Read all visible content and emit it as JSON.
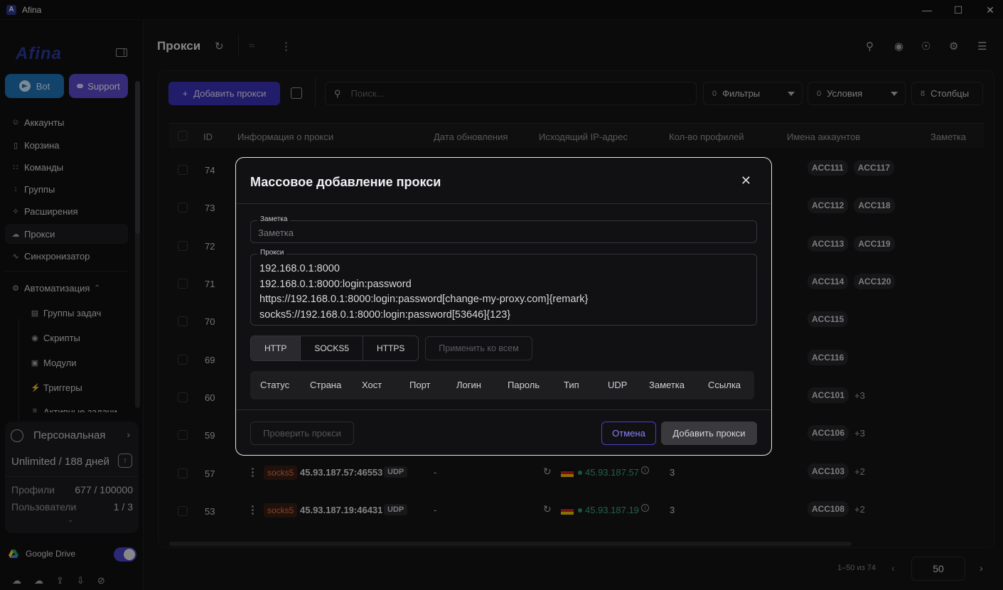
{
  "window": {
    "title": "Afina",
    "icon_letter": "A"
  },
  "sidebar": {
    "logo": "Afina",
    "bot_label": "Bot",
    "support_label": "Support",
    "nav": [
      {
        "label": "Аккаунты",
        "icon": "user-circle-icon"
      },
      {
        "label": "Корзина",
        "icon": "trash-icon"
      },
      {
        "label": "Команды",
        "icon": "team-icon"
      },
      {
        "label": "Группы",
        "icon": "group-icon"
      },
      {
        "label": "Расширения",
        "icon": "puzzle-icon"
      },
      {
        "label": "Прокси",
        "icon": "cloud-icon",
        "active": true
      },
      {
        "label": "Синхронизатор",
        "icon": "sync-icon"
      }
    ],
    "automation": {
      "label": "Автоматизация",
      "items": [
        {
          "label": "Группы задач",
          "icon": "list-icon"
        },
        {
          "label": "Скрипты",
          "icon": "github-icon"
        },
        {
          "label": "Модули",
          "icon": "terminal-icon"
        },
        {
          "label": "Триггеры",
          "icon": "bolt-icon"
        },
        {
          "label": "Активные задачи",
          "icon": "tasks-icon"
        }
      ]
    },
    "plan": {
      "name": "Персональная",
      "limit": "Unlimited / 188 дней",
      "profiles_label": "Профили",
      "profiles_value": "677 / 100000",
      "users_label": "Пользователи",
      "users_value": "1 / 3"
    },
    "gdrive_label": "Google Drive"
  },
  "header": {
    "title": "Прокси"
  },
  "toolbar": {
    "add_label": "Добавить прокси",
    "search_placeholder": "Поиск...",
    "filters": {
      "count": "0",
      "label": "Фильтры"
    },
    "conditions": {
      "count": "0",
      "label": "Условия"
    },
    "columns": {
      "count": "8",
      "label": "Столбцы"
    }
  },
  "table": {
    "headers": {
      "id": "ID",
      "info": "Информация о прокси",
      "updated": "Дата обновления",
      "ip": "Исходящий IP-адрес",
      "profiles": "Кол-во профилей",
      "accounts": "Имена аккаунтов",
      "note": "Заметка"
    },
    "rows": [
      {
        "id": "74",
        "accs": [
          "ACC111",
          "ACC117"
        ],
        "more": ""
      },
      {
        "id": "73",
        "accs": [
          "ACC112",
          "ACC118"
        ],
        "more": ""
      },
      {
        "id": "72",
        "accs": [
          "ACC113",
          "ACC119"
        ],
        "more": ""
      },
      {
        "id": "71",
        "accs": [
          "ACC114",
          "ACC120"
        ],
        "more": ""
      },
      {
        "id": "70",
        "accs": [
          "ACC115"
        ],
        "more": ""
      },
      {
        "id": "69",
        "accs": [
          "ACC116"
        ],
        "more": ""
      },
      {
        "id": "60",
        "accs": [
          "ACC101"
        ],
        "more": "+3"
      },
      {
        "id": "59",
        "accs": [
          "ACC106"
        ],
        "more": "+3"
      },
      {
        "id": "57",
        "type": "socks5",
        "host": "45.93.187.57:46553",
        "udp": "UDP",
        "updated": "-",
        "ip": "45.93.187.57",
        "profiles": "3",
        "accs": [
          "ACC103"
        ],
        "more": "+2"
      },
      {
        "id": "53",
        "type": "socks5",
        "host": "45.93.187.19:46431",
        "udp": "UDP",
        "updated": "-",
        "ip": "45.93.187.19",
        "profiles": "3",
        "accs": [
          "ACC108"
        ],
        "more": "+2"
      }
    ]
  },
  "pagination": {
    "range": "1–50 из 74",
    "page_size": "50"
  },
  "modal": {
    "title": "Массовое добавление прокси",
    "note_label": "Заметка",
    "note_placeholder": "Заметка",
    "proxies_label": "Прокси",
    "proxies_text": "192.168.0.1:8000\n192.168.0.1:8000:login:password\nhttps://192.168.0.1:8000:login:password[change-my-proxy.com]{remark}\nsocks5://192.168.0.1:8000:login:password[53646]{123}",
    "types": [
      "HTTP",
      "SOCKS5",
      "HTTPS"
    ],
    "selected_type": "HTTP",
    "apply_all": "Применить ко всем",
    "columns": [
      "Статус",
      "Страна",
      "Хост",
      "Порт",
      "Логин",
      "Пароль",
      "Тип",
      "UDP",
      "Заметка",
      "Ссылка"
    ],
    "check_label": "Проверить прокси",
    "cancel_label": "Отмена",
    "submit_label": "Добавить прокси"
  },
  "colors": {
    "accent": "#3b33b8",
    "bot": "#1e74b8",
    "support": "#5a4ad0",
    "socks": "#e07840",
    "ip_green": "#3aa579"
  }
}
